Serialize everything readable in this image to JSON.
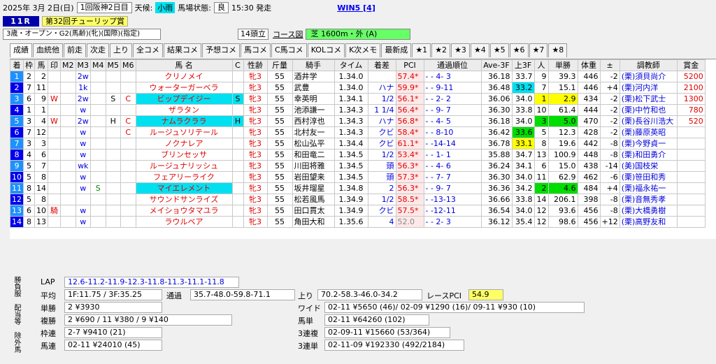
{
  "header": {
    "date": "2025年 3月 2日(日)",
    "meeting": "1回阪神2日目",
    "weather_label": "天候:",
    "weather": "小雨",
    "track_label": "馬場状態:",
    "track": "良",
    "post_time": "15:30 発走",
    "win5": "WIN5 [4]"
  },
  "race": {
    "number": "11R",
    "name": "第32回チューリップ賞",
    "conditions": "3歳・オープン・G2(馬齢)(牝)(国際)(指定)",
    "runners": "14頭立",
    "course_label": "コース図",
    "course": "芝 1600m・外 (A)"
  },
  "tabs": [
    "成績",
    "血統他",
    "前走",
    "次走",
    "上り",
    "全コメ",
    "結果コメ",
    "予想コメ",
    "馬コメ",
    "C馬コメ",
    "KOLコメ",
    "K次メモ",
    "最新成",
    "★1",
    "★2",
    "★3",
    "★4",
    "★5",
    "★6",
    "★7",
    "★8"
  ],
  "columns": [
    "着",
    "枠",
    "馬",
    "印",
    "M2",
    "M3",
    "M4",
    "M5",
    "M6",
    "馬 名",
    "C",
    "性齢",
    "斤量",
    "騎手",
    "タイム",
    "着差",
    "PCI",
    "通過順位",
    "Ave-3F",
    "上3F",
    "人",
    "単勝",
    "体重",
    "±",
    "調教師",
    "賞金"
  ],
  "rows": [
    {
      "pos": "1",
      "waku": "2",
      "uma": "2",
      "mark": "",
      "m2": "",
      "m3": "2w",
      "m4": "",
      "m5": "",
      "m6": "",
      "name": "クリノメイ",
      "c": "",
      "sex": "牝3",
      "kin": "55",
      "jockey": "酒井学",
      "time": "1.34.0",
      "margin": "",
      "pci": "57.4*",
      "pass": "- - 4- 3",
      "ave": "36.18",
      "l3f": "33.7",
      "pop": "9",
      "odds": "39.3",
      "weight": "446",
      "diff": "-2",
      "trainer": "(栗)須貝尚介",
      "prize": "5200"
    },
    {
      "pos": "2",
      "waku": "7",
      "uma": "11",
      "mark": "",
      "m2": "",
      "m3": "1k",
      "m4": "",
      "m5": "",
      "m6": "",
      "name": "ウォーターガーベラ",
      "c": "",
      "sex": "牝3",
      "kin": "55",
      "jockey": "武豊",
      "time": "1.34.0",
      "margin": "ハナ",
      "pci": "59.9*",
      "pass": "- - 9-11",
      "ave": "36.48",
      "l3f": "33.2",
      "pop": "7",
      "odds": "15.1",
      "weight": "446",
      "diff": "+4",
      "trainer": "(栗)河内洋",
      "prize": "2100"
    },
    {
      "pos": "3",
      "waku": "6",
      "uma": "9",
      "mark": "W",
      "m2": "",
      "m3": "2w",
      "m4": "",
      "m5": "S",
      "m6": "C",
      "name": "ビップデイジー",
      "c": "S",
      "sex": "牝3",
      "kin": "55",
      "jockey": "幸英明",
      "time": "1.34.1",
      "margin": "1/2",
      "pci": "56.1*",
      "pass": "- - 2- 2",
      "ave": "36.06",
      "l3f": "34.0",
      "pop": "1",
      "odds": "2.9",
      "weight": "434",
      "diff": "-2",
      "trainer": "(栗)松下武士",
      "prize": "1300"
    },
    {
      "pos": "4",
      "waku": "1",
      "uma": "1",
      "mark": "",
      "m2": "",
      "m3": "w",
      "m4": "",
      "m5": "",
      "m6": "",
      "name": "ザラタン",
      "c": "",
      "sex": "牝3",
      "kin": "55",
      "jockey": "池添謙一",
      "time": "1.34.3",
      "margin": "1 1/4",
      "pci": "56.4*",
      "pass": "- - 9- 7",
      "ave": "36.30",
      "l3f": "33.8",
      "pop": "10",
      "odds": "61.4",
      "weight": "444",
      "diff": "-2",
      "trainer": "(栗)中竹和也",
      "prize": "780"
    },
    {
      "pos": "5",
      "waku": "3",
      "uma": "4",
      "mark": "W",
      "m2": "",
      "m3": "2w",
      "m4": "",
      "m5": "H",
      "m6": "C",
      "name": "ナムラクララ",
      "c": "H",
      "sex": "牝3",
      "kin": "55",
      "jockey": "西村淳也",
      "time": "1.34.3",
      "margin": "ハナ",
      "pci": "56.8*",
      "pass": "- - 4- 5",
      "ave": "36.18",
      "l3f": "34.0",
      "pop": "3",
      "odds": "5.0",
      "weight": "470",
      "diff": "-2",
      "trainer": "(栗)長谷川浩大",
      "prize": "520"
    },
    {
      "pos": "6",
      "waku": "7",
      "uma": "12",
      "mark": "",
      "m2": "",
      "m3": "w",
      "m4": "",
      "m5": "",
      "m6": "C",
      "name": "ルージュソリテール",
      "c": "",
      "sex": "牝3",
      "kin": "55",
      "jockey": "北村友一",
      "time": "1.34.3",
      "margin": "クビ",
      "pci": "58.4*",
      "pass": "- - 8-10",
      "ave": "36.42",
      "l3f": "33.6",
      "pop": "5",
      "odds": "12.3",
      "weight": "428",
      "diff": "-2",
      "trainer": "(栗)藤原英昭",
      "prize": ""
    },
    {
      "pos": "7",
      "waku": "3",
      "uma": "3",
      "mark": "",
      "m2": "",
      "m3": "w",
      "m4": "",
      "m5": "",
      "m6": "",
      "name": "ノクナレア",
      "c": "",
      "sex": "牝3",
      "kin": "55",
      "jockey": "松山弘平",
      "time": "1.34.4",
      "margin": "クビ",
      "pci": "61.1*",
      "pass": "- -14-14",
      "ave": "36.78",
      "l3f": "33.1",
      "pop": "8",
      "odds": "19.6",
      "weight": "442",
      "diff": "-8",
      "trainer": "(栗)今野貞一",
      "prize": ""
    },
    {
      "pos": "8",
      "waku": "4",
      "uma": "6",
      "mark": "",
      "m2": "",
      "m3": "w",
      "m4": "",
      "m5": "",
      "m6": "",
      "name": "ブリンセッサ",
      "c": "",
      "sex": "牝3",
      "kin": "55",
      "jockey": "和田竜二",
      "time": "1.34.5",
      "margin": "1/2",
      "pci": "53.4*",
      "pass": "- - 1- 1",
      "ave": "35.88",
      "l3f": "34.7",
      "pop": "13",
      "odds": "100.9",
      "weight": "448",
      "diff": "-8",
      "trainer": "(栗)和田勇介",
      "prize": ""
    },
    {
      "pos": "9",
      "waku": "5",
      "uma": "7",
      "mark": "",
      "m2": "",
      "m3": "wk",
      "m4": "",
      "m5": "",
      "m6": "",
      "name": "ルージュナリッシュ",
      "c": "",
      "sex": "牝3",
      "kin": "55",
      "jockey": "川田将雅",
      "time": "1.34.5",
      "margin": "頭",
      "pci": "56.3*",
      "pass": "- - 4- 6",
      "ave": "36.24",
      "l3f": "34.1",
      "pop": "6",
      "odds": "15.0",
      "weight": "438",
      "diff": "-14",
      "trainer": "(美)国枝栄",
      "prize": ""
    },
    {
      "pos": "10",
      "waku": "5",
      "uma": "8",
      "mark": "",
      "m2": "",
      "m3": "w",
      "m4": "",
      "m5": "",
      "m6": "",
      "name": "フェアリーライク",
      "c": "",
      "sex": "牝3",
      "kin": "55",
      "jockey": "岩田望来",
      "time": "1.34.5",
      "margin": "頭",
      "pci": "57.3*",
      "pass": "- - 7- 7",
      "ave": "36.30",
      "l3f": "34.0",
      "pop": "11",
      "odds": "62.9",
      "weight": "462",
      "diff": "-6",
      "trainer": "(栗)笹田和秀",
      "prize": ""
    },
    {
      "pos": "11",
      "waku": "8",
      "uma": "14",
      "mark": "",
      "m2": "",
      "m3": "w",
      "m4": "S",
      "m5": "",
      "m6": "",
      "name": "マイエレメント",
      "c": "",
      "sex": "牝3",
      "kin": "55",
      "jockey": "坂井瑠星",
      "time": "1.34.8",
      "margin": "2",
      "pci": "56.3*",
      "pass": "- - 9- 7",
      "ave": "36.36",
      "l3f": "34.2",
      "pop": "2",
      "odds": "4.6",
      "weight": "484",
      "diff": "+4",
      "trainer": "(栗)福永祐一",
      "prize": ""
    },
    {
      "pos": "12",
      "waku": "5",
      "uma": "8",
      "mark": "",
      "m2": "",
      "m3": "",
      "m4": "",
      "m5": "",
      "m6": "",
      "name": "サウンドサンライズ",
      "c": "",
      "sex": "牝3",
      "kin": "55",
      "jockey": "松若風馬",
      "time": "1.34.9",
      "margin": "1/2",
      "pci": "58.5*",
      "pass": "- -13-13",
      "ave": "36.66",
      "l3f": "33.8",
      "pop": "14",
      "odds": "206.1",
      "weight": "398",
      "diff": "-8",
      "trainer": "(栗)音無秀孝",
      "prize": ""
    },
    {
      "pos": "13",
      "waku": "6",
      "uma": "10",
      "mark": "騎",
      "m2": "",
      "m3": "w",
      "m4": "",
      "m5": "",
      "m6": "",
      "name": "メイショウタマユラ",
      "c": "",
      "sex": "牝3",
      "kin": "55",
      "jockey": "田口貫太",
      "time": "1.34.9",
      "margin": "クビ",
      "pci": "57.5*",
      "pass": "- -12-11",
      "ave": "36.54",
      "l3f": "34.0",
      "pop": "12",
      "odds": "93.6",
      "weight": "456",
      "diff": "-8",
      "trainer": "(栗)大橋勇樹",
      "prize": ""
    },
    {
      "pos": "14",
      "waku": "8",
      "uma": "13",
      "mark": "",
      "m2": "",
      "m3": "w",
      "m4": "",
      "m5": "",
      "m6": "",
      "name": "ラウルベア",
      "c": "",
      "sex": "牝3",
      "kin": "55",
      "jockey": "角田大和",
      "time": "1.35.6",
      "margin": "4",
      "pci": "52.0",
      "pass": "- - 2- 3",
      "ave": "36.12",
      "l3f": "35.4",
      "pop": "12",
      "odds": "98.6",
      "weight": "456",
      "diff": "+12",
      "trainer": "(栗)高野友和",
      "prize": ""
    }
  ],
  "summary": {
    "lap_label": "LAP",
    "lap": "12.6-11.2-11.9-12.3-11.8-11.3-11.1-11.8",
    "avg_label": "平均",
    "avg": "1F:11.75 / 3F:35.25",
    "pass_label": "通過",
    "pass": "35.7-48.0-59.8-71.1",
    "agari_label": "上り",
    "agari": "70.2-58.3-46.0-34.2",
    "rpci_label": "レースPCI",
    "rpci": "54.9",
    "side_tabs": [
      "勝負服",
      "配当等",
      "除外馬"
    ],
    "payouts": [
      {
        "label": "単勝",
        "value": "2 ¥3930"
      },
      {
        "label": "複勝",
        "value": "2 ¥690 / 11 ¥380 / 9 ¥140"
      },
      {
        "label": "枠連",
        "value": "2-7 ¥9410 (21)"
      },
      {
        "label": "馬連",
        "value": "02-11 ¥24010 (45)"
      },
      {
        "label": "ワイド",
        "value": "02-11 ¥5650 (46)/ 02-09 ¥1290 (16)/ 09-11 ¥930 (10)"
      },
      {
        "label": "馬単",
        "value": "02-11 ¥64260 (102)"
      },
      {
        "label": "3連複",
        "value": "02-09-11 ¥15660 (53/364)"
      },
      {
        "label": "3連単",
        "value": "02-11-09 ¥192330 (492/2184)"
      }
    ]
  }
}
